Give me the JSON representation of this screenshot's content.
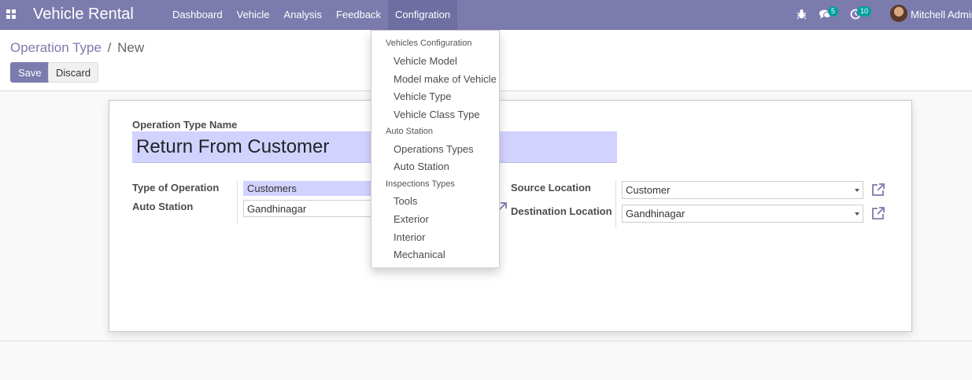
{
  "navbar": {
    "brand": "Vehicle Rental",
    "menu": [
      "Dashboard",
      "Vehicle",
      "Analysis",
      "Feedback",
      "Configration"
    ],
    "messages_count": "5",
    "activities_count": "10",
    "user": "Mitchell Admin",
    "colors": {
      "bar": "#7c7bad",
      "badge": "#00a09d"
    }
  },
  "breadcrumb": {
    "parent": "Operation Type",
    "separator": "/",
    "current": "New"
  },
  "buttons": {
    "save": "Save",
    "discard": "Discard"
  },
  "form": {
    "name_label": "Operation Type Name",
    "name_value": "Return From Customer",
    "type_label": "Type of Operation",
    "type_value": "Customers",
    "station_label": "Auto Station",
    "station_value": "Gandhinagar",
    "source_label": "Source Location",
    "source_value": "Customer",
    "dest_label": "Destination Location",
    "dest_value": "Gandhinagar"
  },
  "dropdown": {
    "sections": [
      {
        "header": "Vehicles Configuration",
        "items": [
          "Vehicle Model",
          "Model make of Vehicle",
          "Vehicle Type",
          "Vehicle Class Type"
        ]
      },
      {
        "header": "Auto Station",
        "items": [
          "Operations Types",
          "Auto Station"
        ]
      },
      {
        "header": "Inspections Types",
        "items": [
          "Tools",
          "Exterior",
          "Interior",
          "Mechanical"
        ]
      }
    ]
  },
  "icons": [
    "apps-icon",
    "bug-icon",
    "chat-icon",
    "clock-icon",
    "external-link-icon",
    "caret-down-icon"
  ]
}
